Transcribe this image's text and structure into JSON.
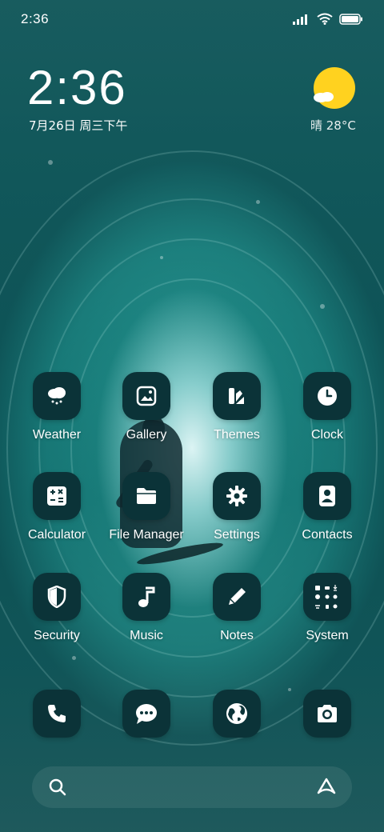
{
  "status_bar": {
    "time": "2:36",
    "icons": [
      "signal-icon",
      "wifi-icon",
      "battery-icon"
    ]
  },
  "widget": {
    "clock": "2:36",
    "date": "7月26日 周三下午",
    "weather": "晴 28°C",
    "weather_icon": "sunny-cloud-icon"
  },
  "apps": [
    {
      "label": "Weather",
      "icon": "cloud-rain-icon"
    },
    {
      "label": "Gallery",
      "icon": "image-icon"
    },
    {
      "label": "Themes",
      "icon": "themes-icon"
    },
    {
      "label": "Clock",
      "icon": "clock-icon"
    },
    {
      "label": "Calculator",
      "icon": "calculator-icon"
    },
    {
      "label": "File Manager",
      "icon": "folder-icon"
    },
    {
      "label": "Settings",
      "icon": "gear-icon"
    },
    {
      "label": "Contacts",
      "icon": "person-icon"
    },
    {
      "label": "Security",
      "icon": "shield-icon"
    },
    {
      "label": "Music",
      "icon": "music-note-icon"
    },
    {
      "label": "Notes",
      "icon": "pencil-icon"
    },
    {
      "label": "System",
      "icon": "system-folder-icon"
    }
  ],
  "dock": [
    {
      "icon": "phone-icon"
    },
    {
      "icon": "message-icon"
    },
    {
      "icon": "globe-icon"
    },
    {
      "icon": "camera-icon"
    }
  ],
  "search": {
    "left_icon": "search-icon",
    "right_icon": "assistant-icon"
  },
  "colors": {
    "icon_bg": "#0b3338",
    "sun": "#ffd21f",
    "wallpaper_main": "#1f8a86"
  }
}
